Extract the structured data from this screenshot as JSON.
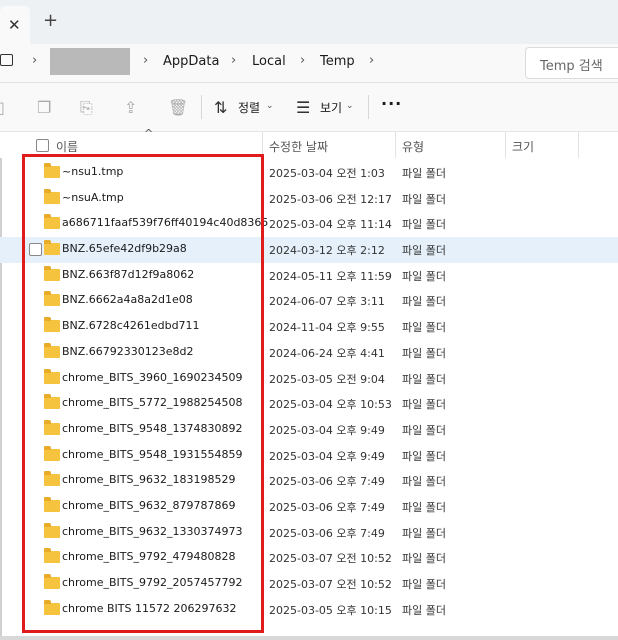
{
  "tabs": {
    "close_glyph": "✕",
    "new_tab_glyph": "+"
  },
  "address": {
    "crumbs": [
      "AppData",
      "Local",
      "Temp"
    ],
    "separator": "›",
    "search_placeholder": "Temp 검색"
  },
  "toolbar": {
    "sort_label": "정렬",
    "view_label": "보기",
    "more_label": "···"
  },
  "columns": {
    "name": "이름",
    "date": "수정한 날짜",
    "type": "유형",
    "size": "크기"
  },
  "rows": [
    {
      "name": "~nsu1.tmp",
      "date": "2025-03-04 오전 1:03",
      "type": "파일 폴더"
    },
    {
      "name": "~nsuA.tmp",
      "date": "2025-03-06 오전 12:17",
      "type": "파일 폴더"
    },
    {
      "name": "a686711faaf539f76ff40194c40d8365",
      "date": "2025-03-04 오후 11:14",
      "type": "파일 폴더"
    },
    {
      "name": "BNZ.65efe42df9b29a8",
      "date": "2024-03-12 오후 2:12",
      "type": "파일 폴더"
    },
    {
      "name": "BNZ.663f87d12f9a8062",
      "date": "2024-05-11 오후 11:59",
      "type": "파일 폴더"
    },
    {
      "name": "BNZ.6662a4a8a2d1e08",
      "date": "2024-06-07 오후 3:11",
      "type": "파일 폴더"
    },
    {
      "name": "BNZ.6728c4261edbd711",
      "date": "2024-11-04 오후 9:55",
      "type": "파일 폴더"
    },
    {
      "name": "BNZ.66792330123e8d2",
      "date": "2024-06-24 오후 4:41",
      "type": "파일 폴더"
    },
    {
      "name": "chrome_BITS_3960_1690234509",
      "date": "2025-03-05 오전 9:04",
      "type": "파일 폴더"
    },
    {
      "name": "chrome_BITS_5772_1988254508",
      "date": "2025-03-04 오후 10:53",
      "type": "파일 폴더"
    },
    {
      "name": "chrome_BITS_9548_1374830892",
      "date": "2025-03-04 오후 9:49",
      "type": "파일 폴더"
    },
    {
      "name": "chrome_BITS_9548_1931554859",
      "date": "2025-03-04 오후 9:49",
      "type": "파일 폴더"
    },
    {
      "name": "chrome_BITS_9632_183198529",
      "date": "2025-03-06 오후 7:49",
      "type": "파일 폴더"
    },
    {
      "name": "chrome_BITS_9632_879787869",
      "date": "2025-03-06 오후 7:49",
      "type": "파일 폴더"
    },
    {
      "name": "chrome_BITS_9632_1330374973",
      "date": "2025-03-06 오후 7:49",
      "type": "파일 폴더"
    },
    {
      "name": "chrome_BITS_9792_479480828",
      "date": "2025-03-07 오전 10:52",
      "type": "파일 폴더"
    },
    {
      "name": "chrome_BITS_9792_2057457792",
      "date": "2025-03-07 오전 10:52",
      "type": "파일 폴더"
    },
    {
      "name": "chrome BITS 11572 206297632",
      "date": "2025-03-05 오후 10:15",
      "type": "파일 폴더"
    }
  ],
  "selected_row": "BNZ.65efe42df9b29a8",
  "colors": {
    "highlight_box": "#e01b1b",
    "selection": "#e5f0fa",
    "folder": "#f6c33f"
  }
}
